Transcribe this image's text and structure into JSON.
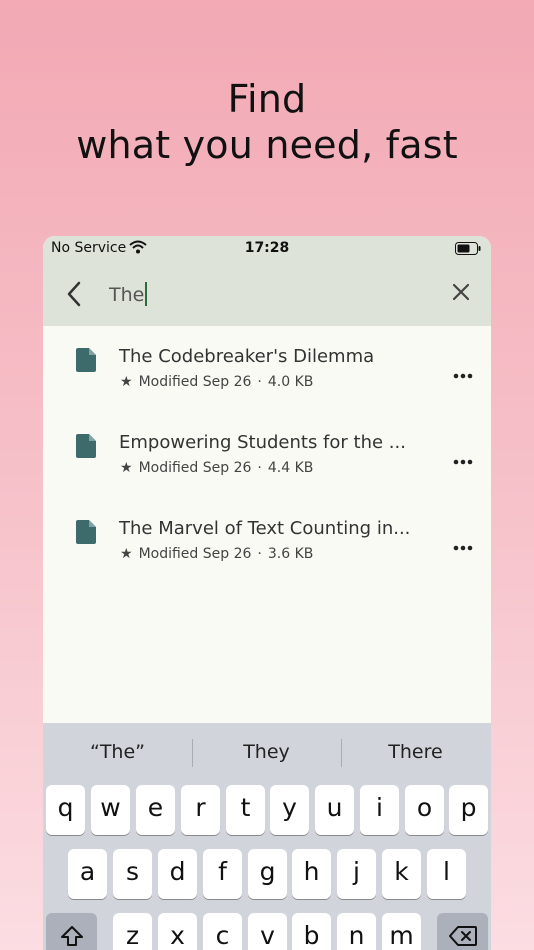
{
  "headline": {
    "line1": "Find",
    "line2": "what you need, fast"
  },
  "status": {
    "carrier": "No Service",
    "time": "17:28"
  },
  "search": {
    "query": "The"
  },
  "results": [
    {
      "title": "The Codebreaker's Dilemma",
      "modified": "Modified Sep 26",
      "size": "4.0 KB"
    },
    {
      "title": "Empowering Students for the ...",
      "modified": "Modified Sep 26",
      "size": "4.4 KB"
    },
    {
      "title": "The Marvel of Text Counting in...",
      "modified": "Modified Sep 26",
      "size": "3.6 KB"
    }
  ],
  "keyboard": {
    "suggestions": [
      "“The”",
      "They",
      "There"
    ],
    "row1": [
      "q",
      "w",
      "e",
      "r",
      "t",
      "y",
      "u",
      "i",
      "o",
      "p"
    ],
    "row2": [
      "a",
      "s",
      "d",
      "f",
      "g",
      "h",
      "j",
      "k",
      "l"
    ],
    "row3": [
      "z",
      "x",
      "c",
      "v",
      "b",
      "n",
      "m"
    ]
  },
  "colors": {
    "doc_icon": "#3d6b6b",
    "accent": "#2c6b3a"
  }
}
